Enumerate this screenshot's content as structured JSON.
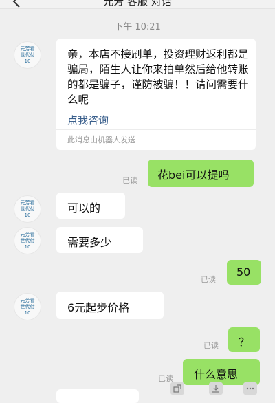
{
  "header": {
    "title": "元芳 客服 对话"
  },
  "timestamp": "下午 10:21",
  "avatar": {
    "line1": "元芳看",
    "line2": "世代付",
    "line3": "10"
  },
  "messages": [
    {
      "side": "left",
      "type": "card",
      "text": "亲，本店不接刷单，投资理财返利都是骗局，陌生人让你来拍单然后给他转账的都是骗子，谨防被骗！！请问需要什么呢",
      "link": "点我咨询",
      "footer": "此消息由机器人发送"
    },
    {
      "side": "right",
      "text": "花bei可以提吗",
      "status": "已读"
    },
    {
      "side": "left",
      "text": "可以的"
    },
    {
      "side": "left",
      "text": "需要多少"
    },
    {
      "side": "right",
      "text": "50",
      "status": "已读"
    },
    {
      "side": "left",
      "text": "6元起步价格"
    },
    {
      "side": "right",
      "text": "？",
      "status": "已读"
    },
    {
      "side": "right",
      "text": "什么意思",
      "status": "已读"
    }
  ]
}
